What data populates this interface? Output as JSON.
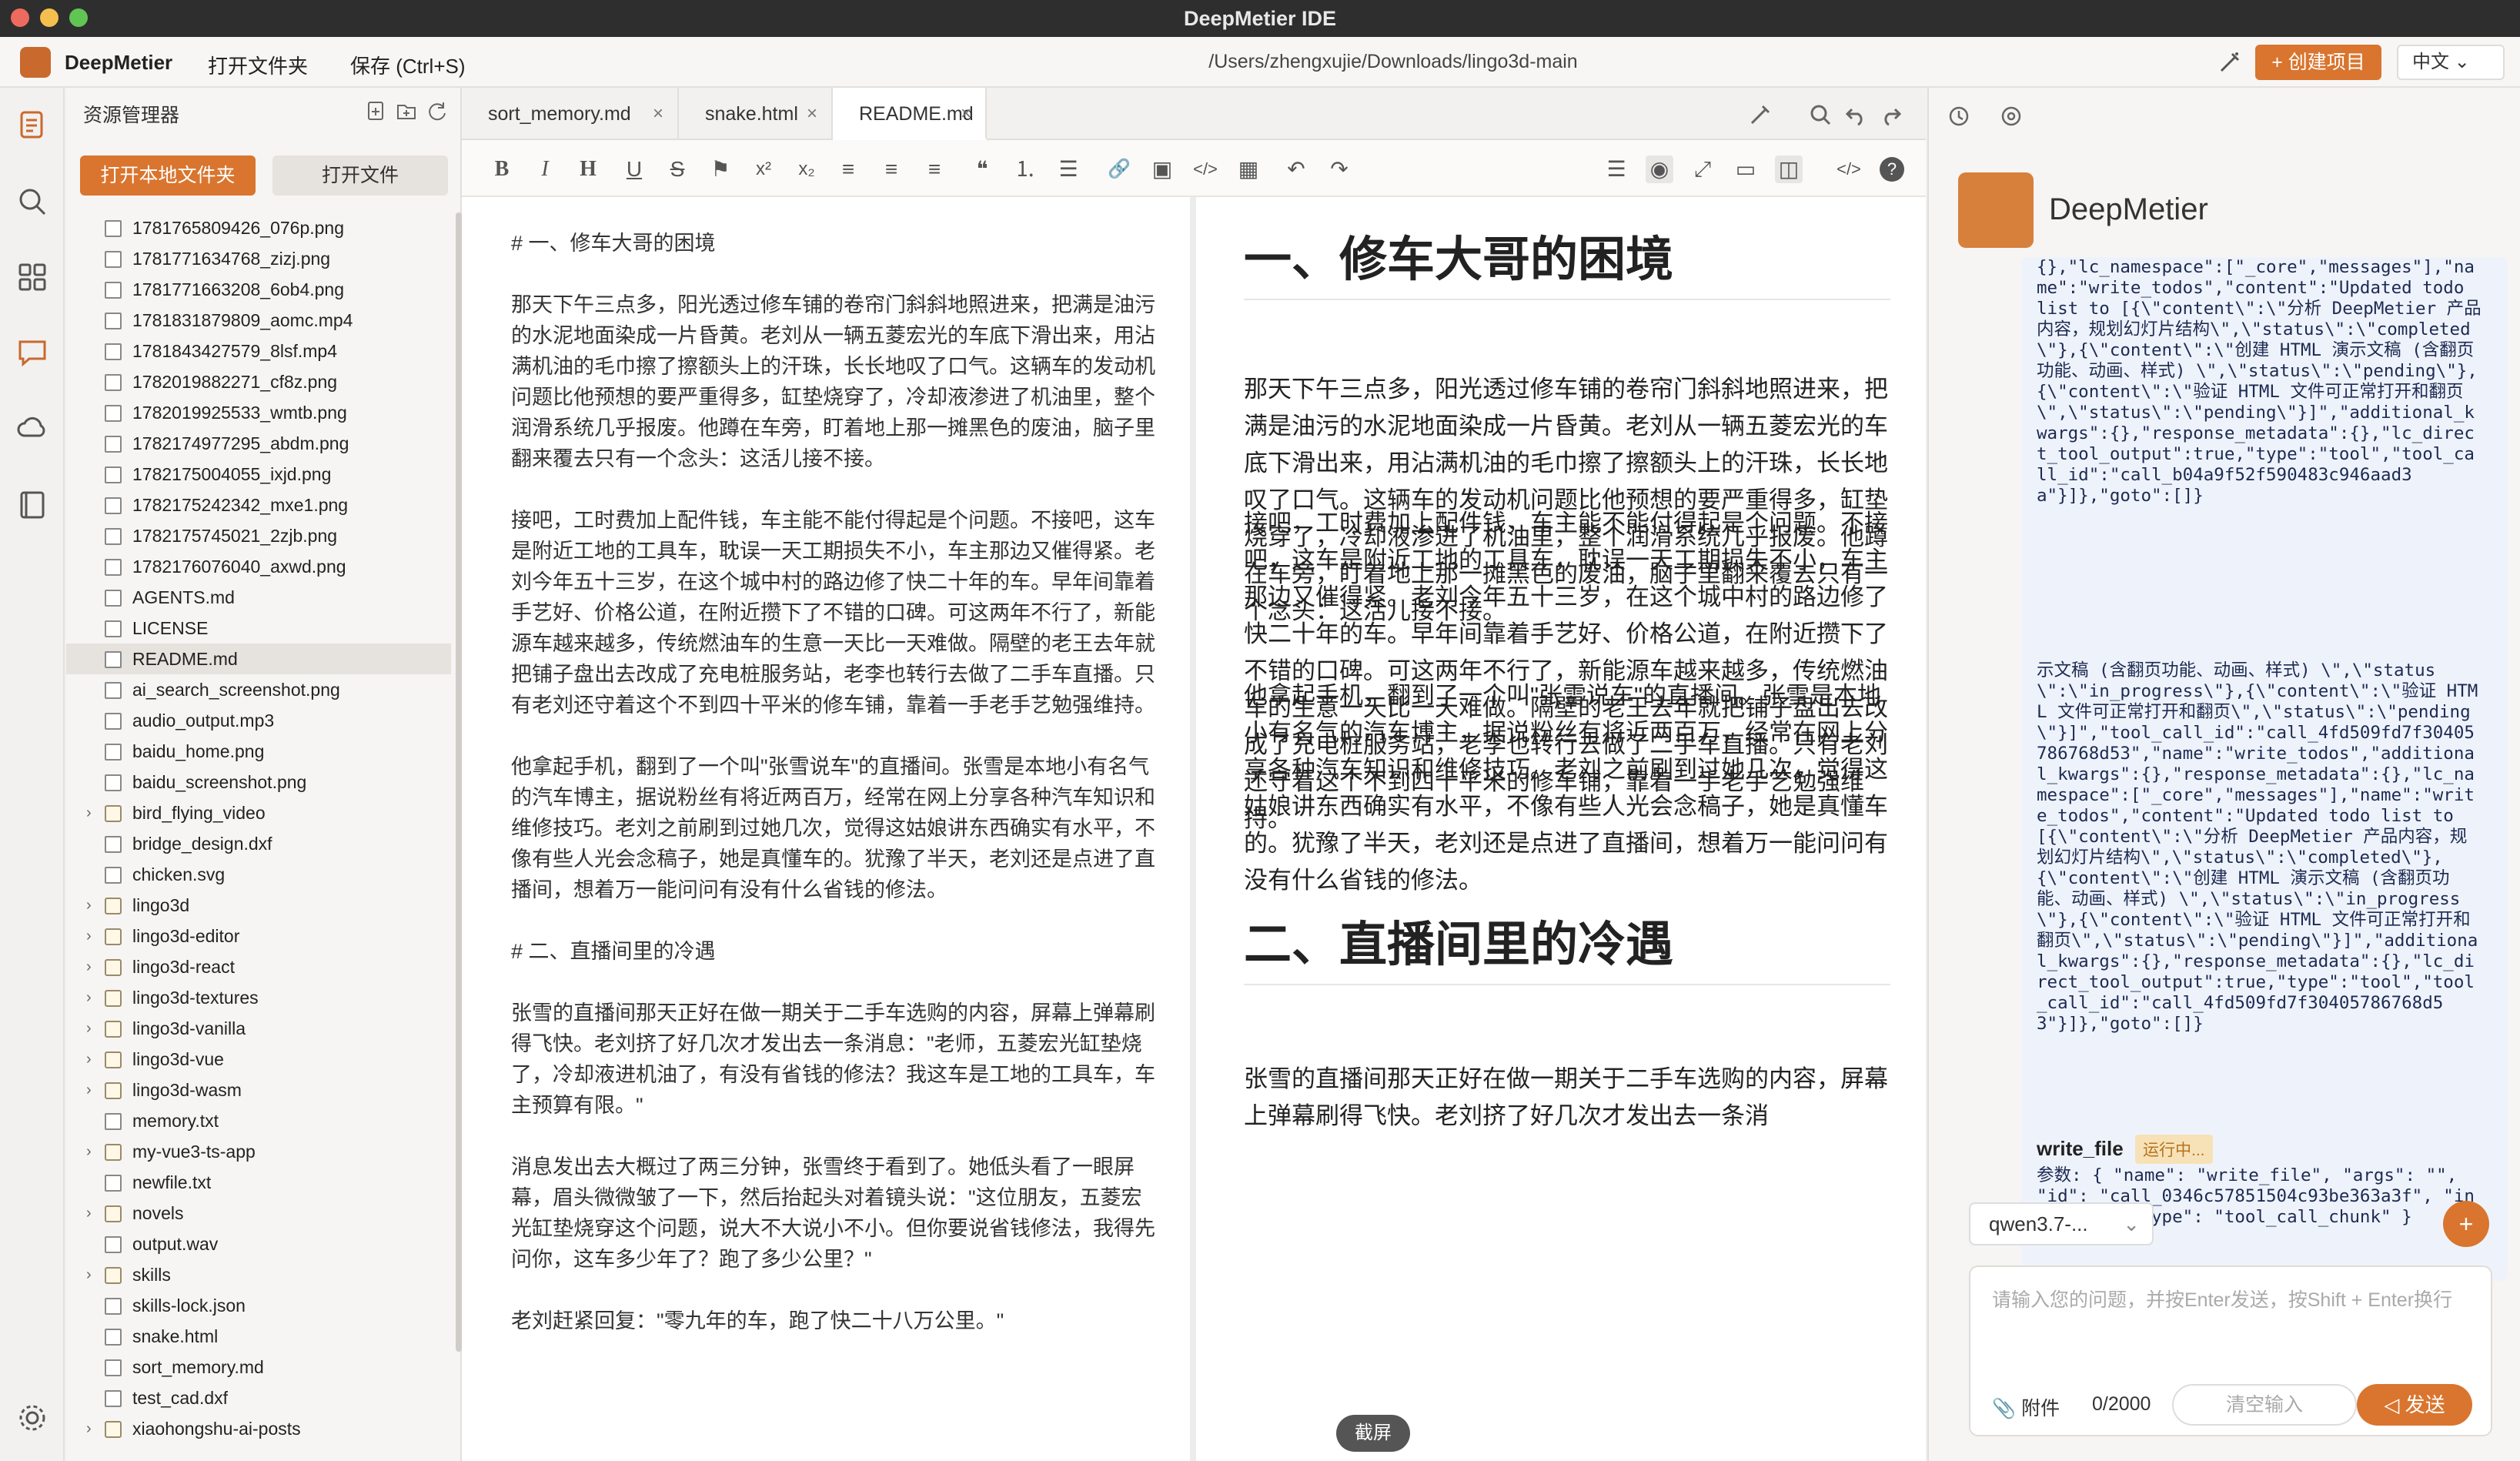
{
  "window": {
    "title": "DeepMetier IDE"
  },
  "menubar": {
    "brand": "DeepMetier",
    "open_folder": "打开文件夹",
    "save": "保存 (Ctrl+S)",
    "path": "/Users/zhengxujie/Downloads/lingo3d-main",
    "create_project": "+ 创建项目",
    "language": "中文 ⌄"
  },
  "sidebar": {
    "title": "资源管理器",
    "open_local_folder": "打开本地文件夹",
    "open_file": "打开文件",
    "files": [
      {
        "name": "1781765809426_076p.png",
        "type": "file"
      },
      {
        "name": "1781771634768_zizj.png",
        "type": "file"
      },
      {
        "name": "1781771663208_6ob4.png",
        "type": "file"
      },
      {
        "name": "1781831879809_aomc.mp4",
        "type": "file"
      },
      {
        "name": "1781843427579_8lsf.mp4",
        "type": "file"
      },
      {
        "name": "1782019882271_cf8z.png",
        "type": "file"
      },
      {
        "name": "1782019925533_wmtb.png",
        "type": "file"
      },
      {
        "name": "1782174977295_abdm.png",
        "type": "file"
      },
      {
        "name": "1782175004055_ixjd.png",
        "type": "file"
      },
      {
        "name": "1782175242342_mxe1.png",
        "type": "file"
      },
      {
        "name": "1782175745021_2zjb.png",
        "type": "file"
      },
      {
        "name": "1782176076040_axwd.png",
        "type": "file"
      },
      {
        "name": "AGENTS.md",
        "type": "file"
      },
      {
        "name": "LICENSE",
        "type": "file"
      },
      {
        "name": "README.md",
        "type": "file",
        "selected": true
      },
      {
        "name": "ai_search_screenshot.png",
        "type": "file"
      },
      {
        "name": "audio_output.mp3",
        "type": "file"
      },
      {
        "name": "baidu_home.png",
        "type": "file"
      },
      {
        "name": "baidu_screenshot.png",
        "type": "file"
      },
      {
        "name": "bird_flying_video",
        "type": "folder"
      },
      {
        "name": "bridge_design.dxf",
        "type": "file"
      },
      {
        "name": "chicken.svg",
        "type": "file"
      },
      {
        "name": "lingo3d",
        "type": "folder"
      },
      {
        "name": "lingo3d-editor",
        "type": "folder"
      },
      {
        "name": "lingo3d-react",
        "type": "folder"
      },
      {
        "name": "lingo3d-textures",
        "type": "folder"
      },
      {
        "name": "lingo3d-vanilla",
        "type": "folder"
      },
      {
        "name": "lingo3d-vue",
        "type": "folder"
      },
      {
        "name": "lingo3d-wasm",
        "type": "folder"
      },
      {
        "name": "memory.txt",
        "type": "file"
      },
      {
        "name": "my-vue3-ts-app",
        "type": "folder"
      },
      {
        "name": "newfile.txt",
        "type": "file"
      },
      {
        "name": "novels",
        "type": "folder"
      },
      {
        "name": "output.wav",
        "type": "file"
      },
      {
        "name": "skills",
        "type": "folder"
      },
      {
        "name": "skills-lock.json",
        "type": "file"
      },
      {
        "name": "snake.html",
        "type": "file"
      },
      {
        "name": "sort_memory.md",
        "type": "file"
      },
      {
        "name": "test_cad.dxf",
        "type": "file"
      },
      {
        "name": "xiaohongshu-ai-posts",
        "type": "folder"
      }
    ]
  },
  "tabs": [
    {
      "label": "sort_memory.md",
      "close": "×"
    },
    {
      "label": "snake.html",
      "close": "×"
    },
    {
      "label": "README.md",
      "close": "×",
      "active": true
    }
  ],
  "toolbar": {
    "bold": "B",
    "italic": "I",
    "heading": "H",
    "underline": "U",
    "strike": "S",
    "mark": "⚑",
    "sup": "x²",
    "sub": "x₂",
    "align_left": "≡",
    "align_center": "≡",
    "align_right": "≡",
    "quote": "❝",
    "ol": "⒈",
    "ul": "☰",
    "link": "🔗",
    "image": "▣",
    "code": "</>",
    "table": "▦",
    "undo": "↶",
    "redo": "↷",
    "menu": "☰",
    "preview": "◉",
    "fullscreen": "⤢",
    "window": "▭",
    "split": "◫",
    "source": "</>",
    "help": "?"
  },
  "source": {
    "h1": "# 一、修车大哥的困境",
    "p1": "那天下午三点多，阳光透过修车铺的卷帘门斜斜地照进来，把满是油污的水泥地面染成一片昏黄。老刘从一辆五菱宏光的车底下滑出来，用沾满机油的毛巾擦了擦额头上的汗珠，长长地叹了口气。这辆车的发动机问题比他预想的要严重得多，缸垫烧穿了，冷却液渗进了机油里，整个润滑系统几乎报废。他蹲在车旁，盯着地上那一摊黑色的废油，脑子里翻来覆去只有一个念头：这活儿接不接。",
    "p2": "接吧，工时费加上配件钱，车主能不能付得起是个问题。不接吧，这车是附近工地的工具车，耽误一天工期损失不小，车主那边又催得紧。老刘今年五十三岁，在这个城中村的路边修了快二十年的车。早年间靠着手艺好、价格公道，在附近攒下了不错的口碑。可这两年不行了，新能源车越来越多，传统燃油车的生意一天比一天难做。隔壁的老王去年就把铺子盘出去改成了充电桩服务站，老李也转行去做了二手车直播。只有老刘还守着这个不到四十平米的修车铺，靠着一手老手艺勉强维持。",
    "p3": "他拿起手机，翻到了一个叫\"张雪说车\"的直播间。张雪是本地小有名气的汽车博主，据说粉丝有将近两百万，经常在网上分享各种汽车知识和维修技巧。老刘之前刷到过她几次，觉得这姑娘讲东西确实有水平，不像有些人光会念稿子，她是真懂车的。犹豫了半天，老刘还是点进了直播间，想着万一能问问有没有什么省钱的修法。",
    "h2": "# 二、直播间里的冷遇",
    "p4": "张雪的直播间那天正好在做一期关于二手车选购的内容，屏幕上弹幕刷得飞快。老刘挤了好几次才发出去一条消息：\"老师，五菱宏光缸垫烧了，冷却液进机油了，有没有省钱的修法？我这车是工地的工具车，车主预算有限。\"",
    "p5": "消息发出去大概过了两三分钟，张雪终于看到了。她低头看了一眼屏幕，眉头微微皱了一下，然后抬起头对着镜头说：\"这位朋友，五菱宏光缸垫烧穿这个问题，说大不大说小不小。但你要说省钱修法，我得先问你，这车多少年了？跑了多少公里？\"",
    "p6": "老刘赶紧回复：\"零九年的车，跑了快二十八万公里。\""
  },
  "preview": {
    "h1": "一、修车大哥的困境",
    "h2": "二、直播间里的冷遇",
    "p4_part": "张雪的直播间那天正好在做一期关于二手车选购的内容，屏幕上弹幕刷得飞快。老刘挤了好几次才发出去一条消"
  },
  "chat": {
    "name": "DeepMetier",
    "log1": "{},\"lc_namespace\":[\"_core\",\"messages\"],\"name\":\"write_todos\",\"content\":\"Updated todo list to [{\\\"content\\\":\\\"分析 DeepMetier 产品内容，规划幻灯片结构\\\",\\\"status\\\":\\\"completed\\\"},{\\\"content\\\":\\\"创建 HTML 演示文稿 (含翻页功能、动画、样式) \\\",\\\"status\\\":\\\"pending\\\"},{\\\"content\\\":\\\"验证 HTML 文件可正常打开和翻页\\\",\\\"status\\\":\\\"pending\\\"}]\",\"additional_kwargs\":{},\"response_metadata\":{},\"lc_direct_tool_output\":true,\"type\":\"tool\",\"tool_call_id\":\"call_b04a9f52f590483c946aad3a\"}]},\"goto\":[]}",
    "log2": "示文稿 (含翻页功能、动画、样式) \\\",\\\"status\\\":\\\"in_progress\\\"},{\\\"content\\\":\\\"验证 HTML 文件可正常打开和翻页\\\",\\\"status\\\":\\\"pending\\\"}]\",\"tool_call_id\":\"call_4fd509fd7f30405786768d53\",\"name\":\"write_todos\",\"additional_kwargs\":{},\"response_metadata\":{},\"lc_namespace\":[\"_core\",\"messages\"],\"name\":\"write_todos\",\"content\":\"Updated todo list to [{\\\"content\\\":\\\"分析 DeepMetier 产品内容，规划幻灯片结构\\\",\\\"status\\\":\\\"completed\\\"},{\\\"content\\\":\\\"创建 HTML 演示文稿 (含翻页功能、动画、样式) \\\",\\\"status\\\":\\\"in_progress\\\"},{\\\"content\\\":\\\"验证 HTML 文件可正常打开和翻页\\\",\\\"status\\\":\\\"pending\\\"}]\",\"additional_kwargs\":{},\"response_metadata\":{},\"lc_direct_tool_output\":true,\"type\":\"tool\",\"tool_call_id\":\"call_4fd509fd7f30405786768d53\"}]},\"goto\":[]}",
    "tool_name": "write_file",
    "tool_status": "运行中...",
    "tool_params": "参数: { \"name\": \"write_file\", \"args\": \"\", \"id\": \"call_0346c57851504c93be363a3f\", \"index\": 0, \"type\": \"tool_call_chunk\" }",
    "model": "qwen3.7-...",
    "model_chevron": "⌄",
    "add": "+",
    "placeholder": "请输入您的问题，并按Enter发送，按Shift + Enter换行",
    "attach": "📎 附件",
    "count": "0/2000",
    "clear": "清空输入",
    "send": "◁ 发送"
  },
  "screenshot_label": "截屏",
  "colors": {
    "accent": "#d9752e",
    "titlebar": "#2e2e2e",
    "selected_row": "#e6e2dd"
  }
}
